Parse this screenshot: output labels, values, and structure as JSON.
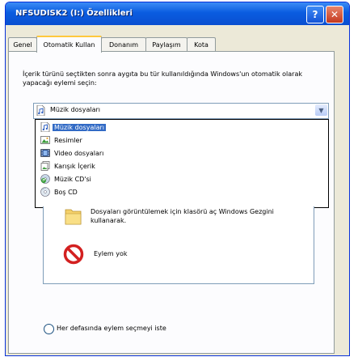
{
  "window": {
    "title": "NFSUDISK2 (I:) Özellikleri"
  },
  "titlebar_buttons": {
    "help": "?",
    "close": "✕"
  },
  "tabs": [
    {
      "label": "Genel",
      "active": false
    },
    {
      "label": "Otomatik Kullan",
      "active": true
    },
    {
      "label": "Donanım",
      "active": false
    },
    {
      "label": "Paylaşım",
      "active": false
    },
    {
      "label": "Kota",
      "active": false
    }
  ],
  "autoplay": {
    "description": "İçerik türünü seçtikten sonra aygıta bu tür kullanıldığında Windows'un otomatik olarak yapacağı eylemi seçin:",
    "content_type": {
      "selected": "Müzik dosyaları",
      "selected_icon": "music-file-icon"
    },
    "dropdown_options": [
      {
        "label": "Müzik dosyaları",
        "icon": "music-file-icon",
        "selected": true
      },
      {
        "label": "Resimler",
        "icon": "picture-icon",
        "selected": false
      },
      {
        "label": "Video dosyaları",
        "icon": "video-file-icon",
        "selected": false
      },
      {
        "label": "Karışık İçerik",
        "icon": "mixed-content-icon",
        "selected": false
      },
      {
        "label": "Müzik CD'si",
        "icon": "music-cd-icon",
        "selected": false
      },
      {
        "label": "Boş CD",
        "icon": "blank-cd-icon",
        "selected": false
      }
    ],
    "actions": [
      {
        "label": "Dosyaları görüntülemek için klasörü aç Windows Gezgini kullanarak.",
        "icon": "folder-icon"
      },
      {
        "label": "Eylem yok",
        "icon": "no-action-icon"
      }
    ],
    "prompt_option": "Her defasında eylem seçmeyi iste"
  },
  "colors": {
    "title_bar": "#0a5ce0",
    "selection": "#316ac5",
    "close_button": "#c4391e",
    "dialog_bg": "#ece9d8"
  }
}
